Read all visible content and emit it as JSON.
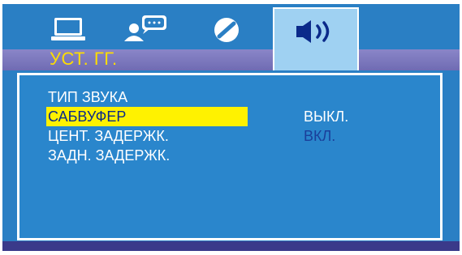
{
  "header": {
    "title": "УСТ. ГГ."
  },
  "tabs": [
    {
      "icon": "monitor-icon"
    },
    {
      "icon": "person-speech-icon"
    },
    {
      "icon": "disc-icon"
    },
    {
      "icon": "speaker-icon",
      "active": true
    }
  ],
  "menu": {
    "items": [
      {
        "label": "ТИП ЗВУКА"
      },
      {
        "label": "САБВУФЕР",
        "selected": true
      },
      {
        "label": "ЦЕНТ. ЗАДЕРЖК."
      },
      {
        "label": "ЗАДН. ЗАДЕРЖК."
      }
    ]
  },
  "options": [
    {
      "label": "ВЫКЛ."
    },
    {
      "label": "ВКЛ."
    }
  ],
  "colors": {
    "background": "#2a7fc4",
    "header": "#7672b8",
    "title": "#ffdd00",
    "selected_bg": "#fff200",
    "active_tab": "#9fd1f2"
  }
}
